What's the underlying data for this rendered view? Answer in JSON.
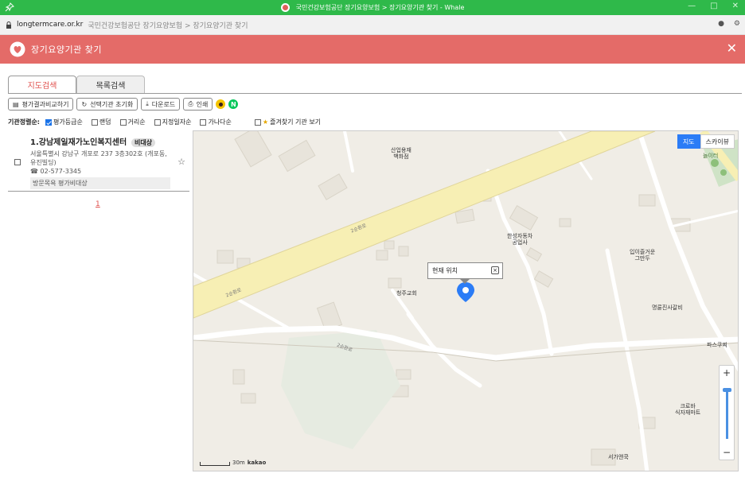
{
  "browser": {
    "window_title": "국민건강보험공단 장기요양보험 > 장기요양기관 찾기 - Whale",
    "url_host": "longtermcare.or.kr",
    "url_path": "국민건강보험공단 장기요양보험 > 장기요양기관 찾기",
    "colors": {
      "titlebar": "#2fb94a"
    }
  },
  "app": {
    "title": "장기요양기관 찾기",
    "colors": {
      "header": "#e46b68",
      "accent": "#e0504d"
    }
  },
  "tabs": [
    {
      "label": "지도검색",
      "active": true
    },
    {
      "label": "목록검색",
      "active": false
    }
  ],
  "toolbar": {
    "compare_label": "평가결과비교하기",
    "reset_label": "선택기관 초기화",
    "download_label": "다운로드",
    "print_label": "인쇄",
    "naver_label": "N"
  },
  "sort": {
    "label": "기관정렬순:",
    "options": [
      {
        "label": "평가등급순",
        "checked": true
      },
      {
        "label": "랜덤",
        "checked": false
      },
      {
        "label": "거리순",
        "checked": false
      },
      {
        "label": "지정일자순",
        "checked": false
      },
      {
        "label": "가나다순",
        "checked": false
      }
    ],
    "favorites_label": "즐겨찾기 기관 보기"
  },
  "results": [
    {
      "name": "1.강남제일재가노인복지센터",
      "badge": "비대상",
      "address": "서울특별시 강남구 개포로 237 3층302호 (개포동, 유진빌딩)",
      "phone": "02-577-3345",
      "visit": "방문목욕 평가비대상"
    }
  ],
  "pager": {
    "current": "1"
  },
  "map": {
    "buttons": [
      "지도",
      "스카이뷰"
    ],
    "popup_label": "현재 위치",
    "popup_close": "×",
    "scale_label": "30m",
    "brand": "kakao",
    "labels": [
      {
        "text": "산업용재\n백화점"
      },
      {
        "text": "한성자동차\n공업사"
      },
      {
        "text": "입이즐거운\n그만두"
      },
      {
        "text": "명륜진사갈비"
      },
      {
        "text": "파스쿠찌"
      },
      {
        "text": "청주교회"
      },
      {
        "text": "크로바\n식자재마트"
      },
      {
        "text": "서가앤쿡"
      },
      {
        "text": "놀이터"
      }
    ],
    "roads": [
      "2순환로",
      "2순환로",
      "2순환로"
    ]
  }
}
